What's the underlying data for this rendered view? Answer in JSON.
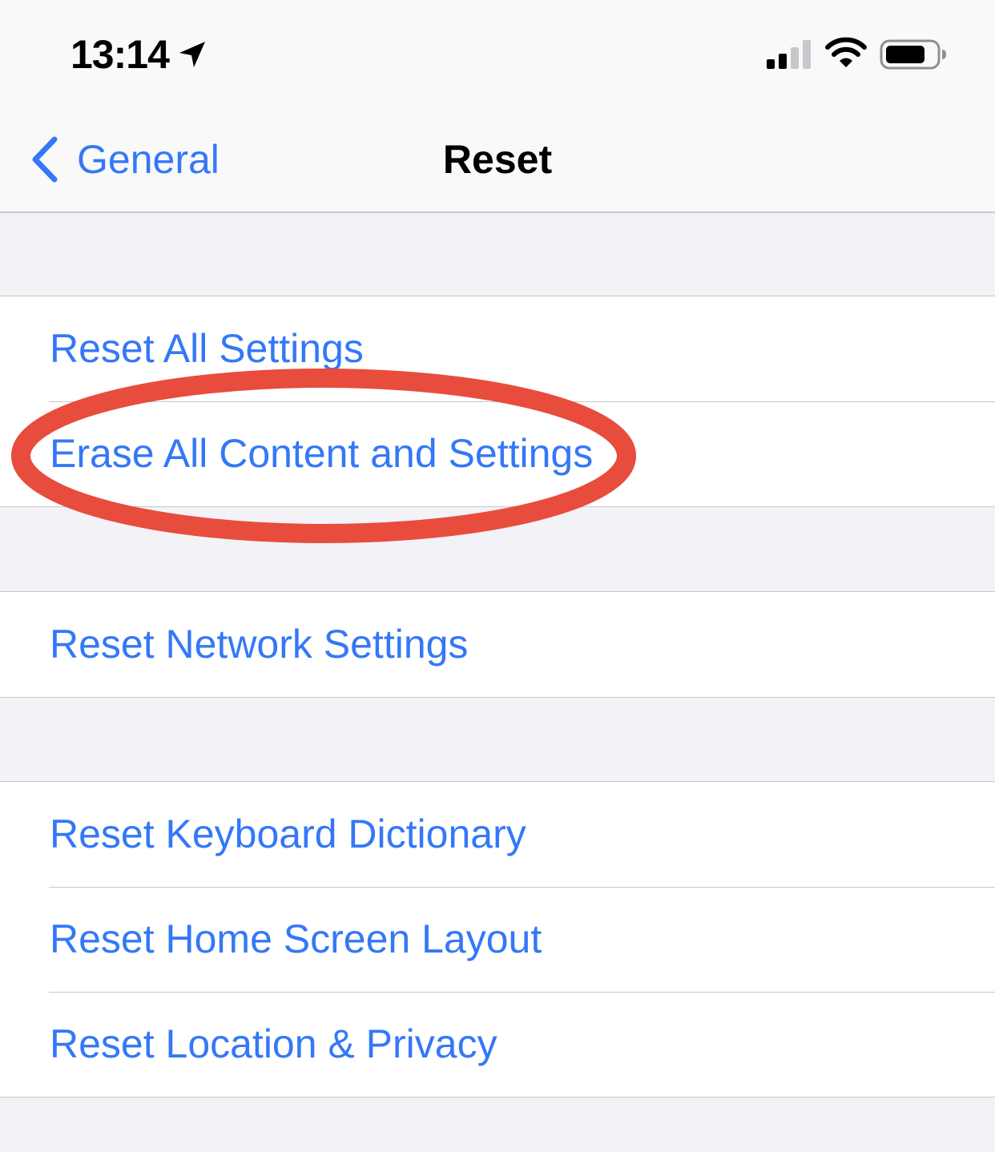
{
  "status_bar": {
    "time": "13:14",
    "icons": [
      "location-arrow-icon",
      "cellular-signal-icon",
      "wifi-icon",
      "battery-icon"
    ]
  },
  "nav": {
    "back_label": "General",
    "title": "Reset"
  },
  "groups": [
    {
      "items": [
        {
          "label": "Reset All Settings"
        },
        {
          "label": "Erase All Content and Settings"
        }
      ]
    },
    {
      "items": [
        {
          "label": "Reset Network Settings"
        }
      ]
    },
    {
      "items": [
        {
          "label": "Reset Keyboard Dictionary"
        },
        {
          "label": "Reset Home Screen Layout"
        },
        {
          "label": "Reset Location & Privacy"
        }
      ]
    }
  ],
  "annotation": {
    "type": "ellipse",
    "highlights": "Erase All Content and Settings",
    "color": "#e84c3d"
  },
  "colors": {
    "accent": "#3478f6",
    "background": "#f2f2f7",
    "cell": "#ffffff",
    "separator": "#c8c7cc"
  }
}
